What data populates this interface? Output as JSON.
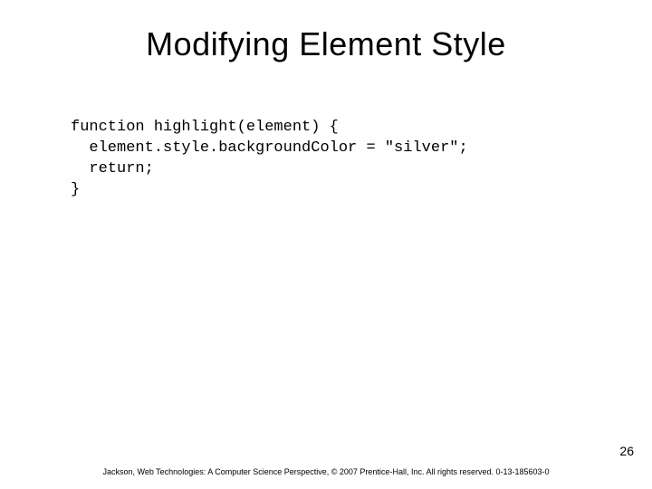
{
  "title": "Modifying Element Style",
  "code": "function highlight(element) {\n  element.style.backgroundColor = \"silver\";\n  return;\n}",
  "page_number": "26",
  "footer": "Jackson, Web Technologies: A Computer Science Perspective, © 2007 Prentice-Hall, Inc. All rights reserved. 0-13-185603-0"
}
